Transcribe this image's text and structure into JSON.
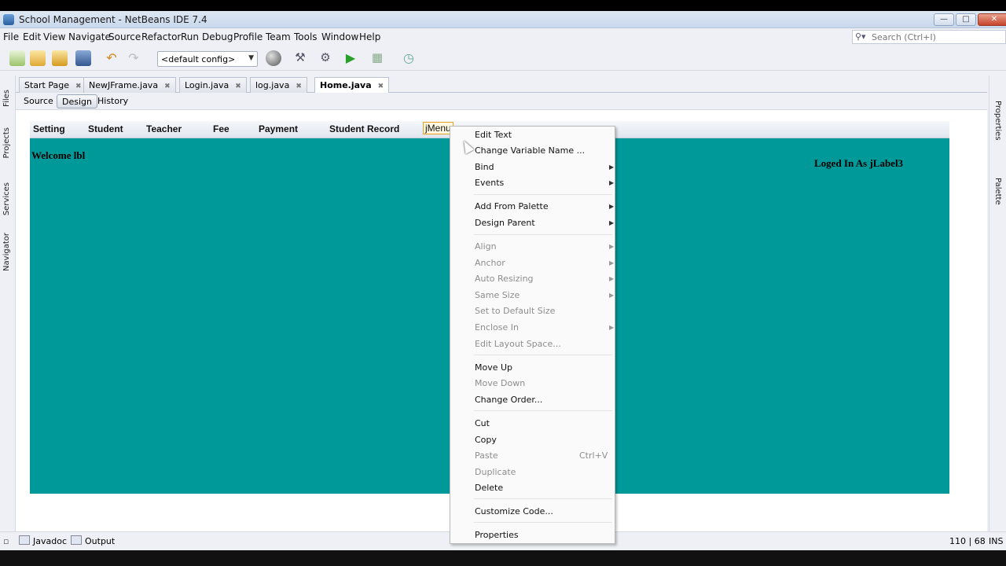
{
  "window": {
    "title": "School Management - NetBeans IDE 7.4"
  },
  "menubar": [
    "File",
    "Edit",
    "View",
    "Navigate",
    "Source",
    "Refactor",
    "Run",
    "Debug",
    "Profile",
    "Team",
    "Tools",
    "Window",
    "Help"
  ],
  "search": {
    "placeholder": "Search (Ctrl+I)"
  },
  "toolbar": {
    "config_value": "<default config>"
  },
  "left_strip": [
    "Files",
    "Projects",
    "Services",
    "Navigator"
  ],
  "right_strip": [
    "Properties",
    "Palette"
  ],
  "editor_tabs": [
    {
      "label": "Start Page",
      "active": false
    },
    {
      "label": "NewJFrame.java",
      "active": false
    },
    {
      "label": "Login.java",
      "active": false
    },
    {
      "label": "log.java",
      "active": false
    },
    {
      "label": "Home.java",
      "active": true
    }
  ],
  "view_buttons": {
    "source": "Source",
    "design": "Design",
    "history": "History"
  },
  "form": {
    "menus": [
      "Setting",
      "Student",
      "Teacher",
      "Fee",
      "Payment",
      "Student Record",
      "jMenu"
    ],
    "welcome_label": "Welcome lbl",
    "logged_label": "Loged In As jLabel3",
    "background": "#009999"
  },
  "context_menu": {
    "items": [
      {
        "label": "Edit Text",
        "enabled": true,
        "submenu": false
      },
      {
        "label": "Change Variable Name ...",
        "enabled": true,
        "submenu": false
      },
      {
        "label": "Bind",
        "enabled": true,
        "submenu": true
      },
      {
        "label": "Events",
        "enabled": true,
        "submenu": true
      },
      {
        "label": "Add From Palette",
        "enabled": true,
        "submenu": true
      },
      {
        "label": "Design Parent",
        "enabled": true,
        "submenu": true
      },
      {
        "label": "Align",
        "enabled": false,
        "submenu": true
      },
      {
        "label": "Anchor",
        "enabled": false,
        "submenu": true
      },
      {
        "label": "Auto Resizing",
        "enabled": false,
        "submenu": true
      },
      {
        "label": "Same Size",
        "enabled": false,
        "submenu": true
      },
      {
        "label": "Set to Default Size",
        "enabled": false,
        "submenu": false
      },
      {
        "label": "Enclose In",
        "enabled": false,
        "submenu": true
      },
      {
        "label": "Edit Layout Space...",
        "enabled": false,
        "submenu": false
      },
      {
        "label": "Move Up",
        "enabled": true,
        "submenu": false
      },
      {
        "label": "Move Down",
        "enabled": false,
        "submenu": false
      },
      {
        "label": "Change Order...",
        "enabled": true,
        "submenu": false
      },
      {
        "label": "Cut",
        "enabled": true,
        "submenu": false
      },
      {
        "label": "Copy",
        "enabled": true,
        "submenu": false
      },
      {
        "label": "Paste",
        "enabled": false,
        "submenu": false,
        "shortcut": "Ctrl+V"
      },
      {
        "label": "Duplicate",
        "enabled": false,
        "submenu": false
      },
      {
        "label": "Delete",
        "enabled": true,
        "submenu": false
      },
      {
        "label": "Customize Code...",
        "enabled": true,
        "submenu": false
      },
      {
        "label": "Properties",
        "enabled": true,
        "submenu": false
      }
    ]
  },
  "bottom": {
    "javadoc": "Javadoc",
    "output": "Output",
    "position": "110 | 68",
    "mode": "INS"
  }
}
